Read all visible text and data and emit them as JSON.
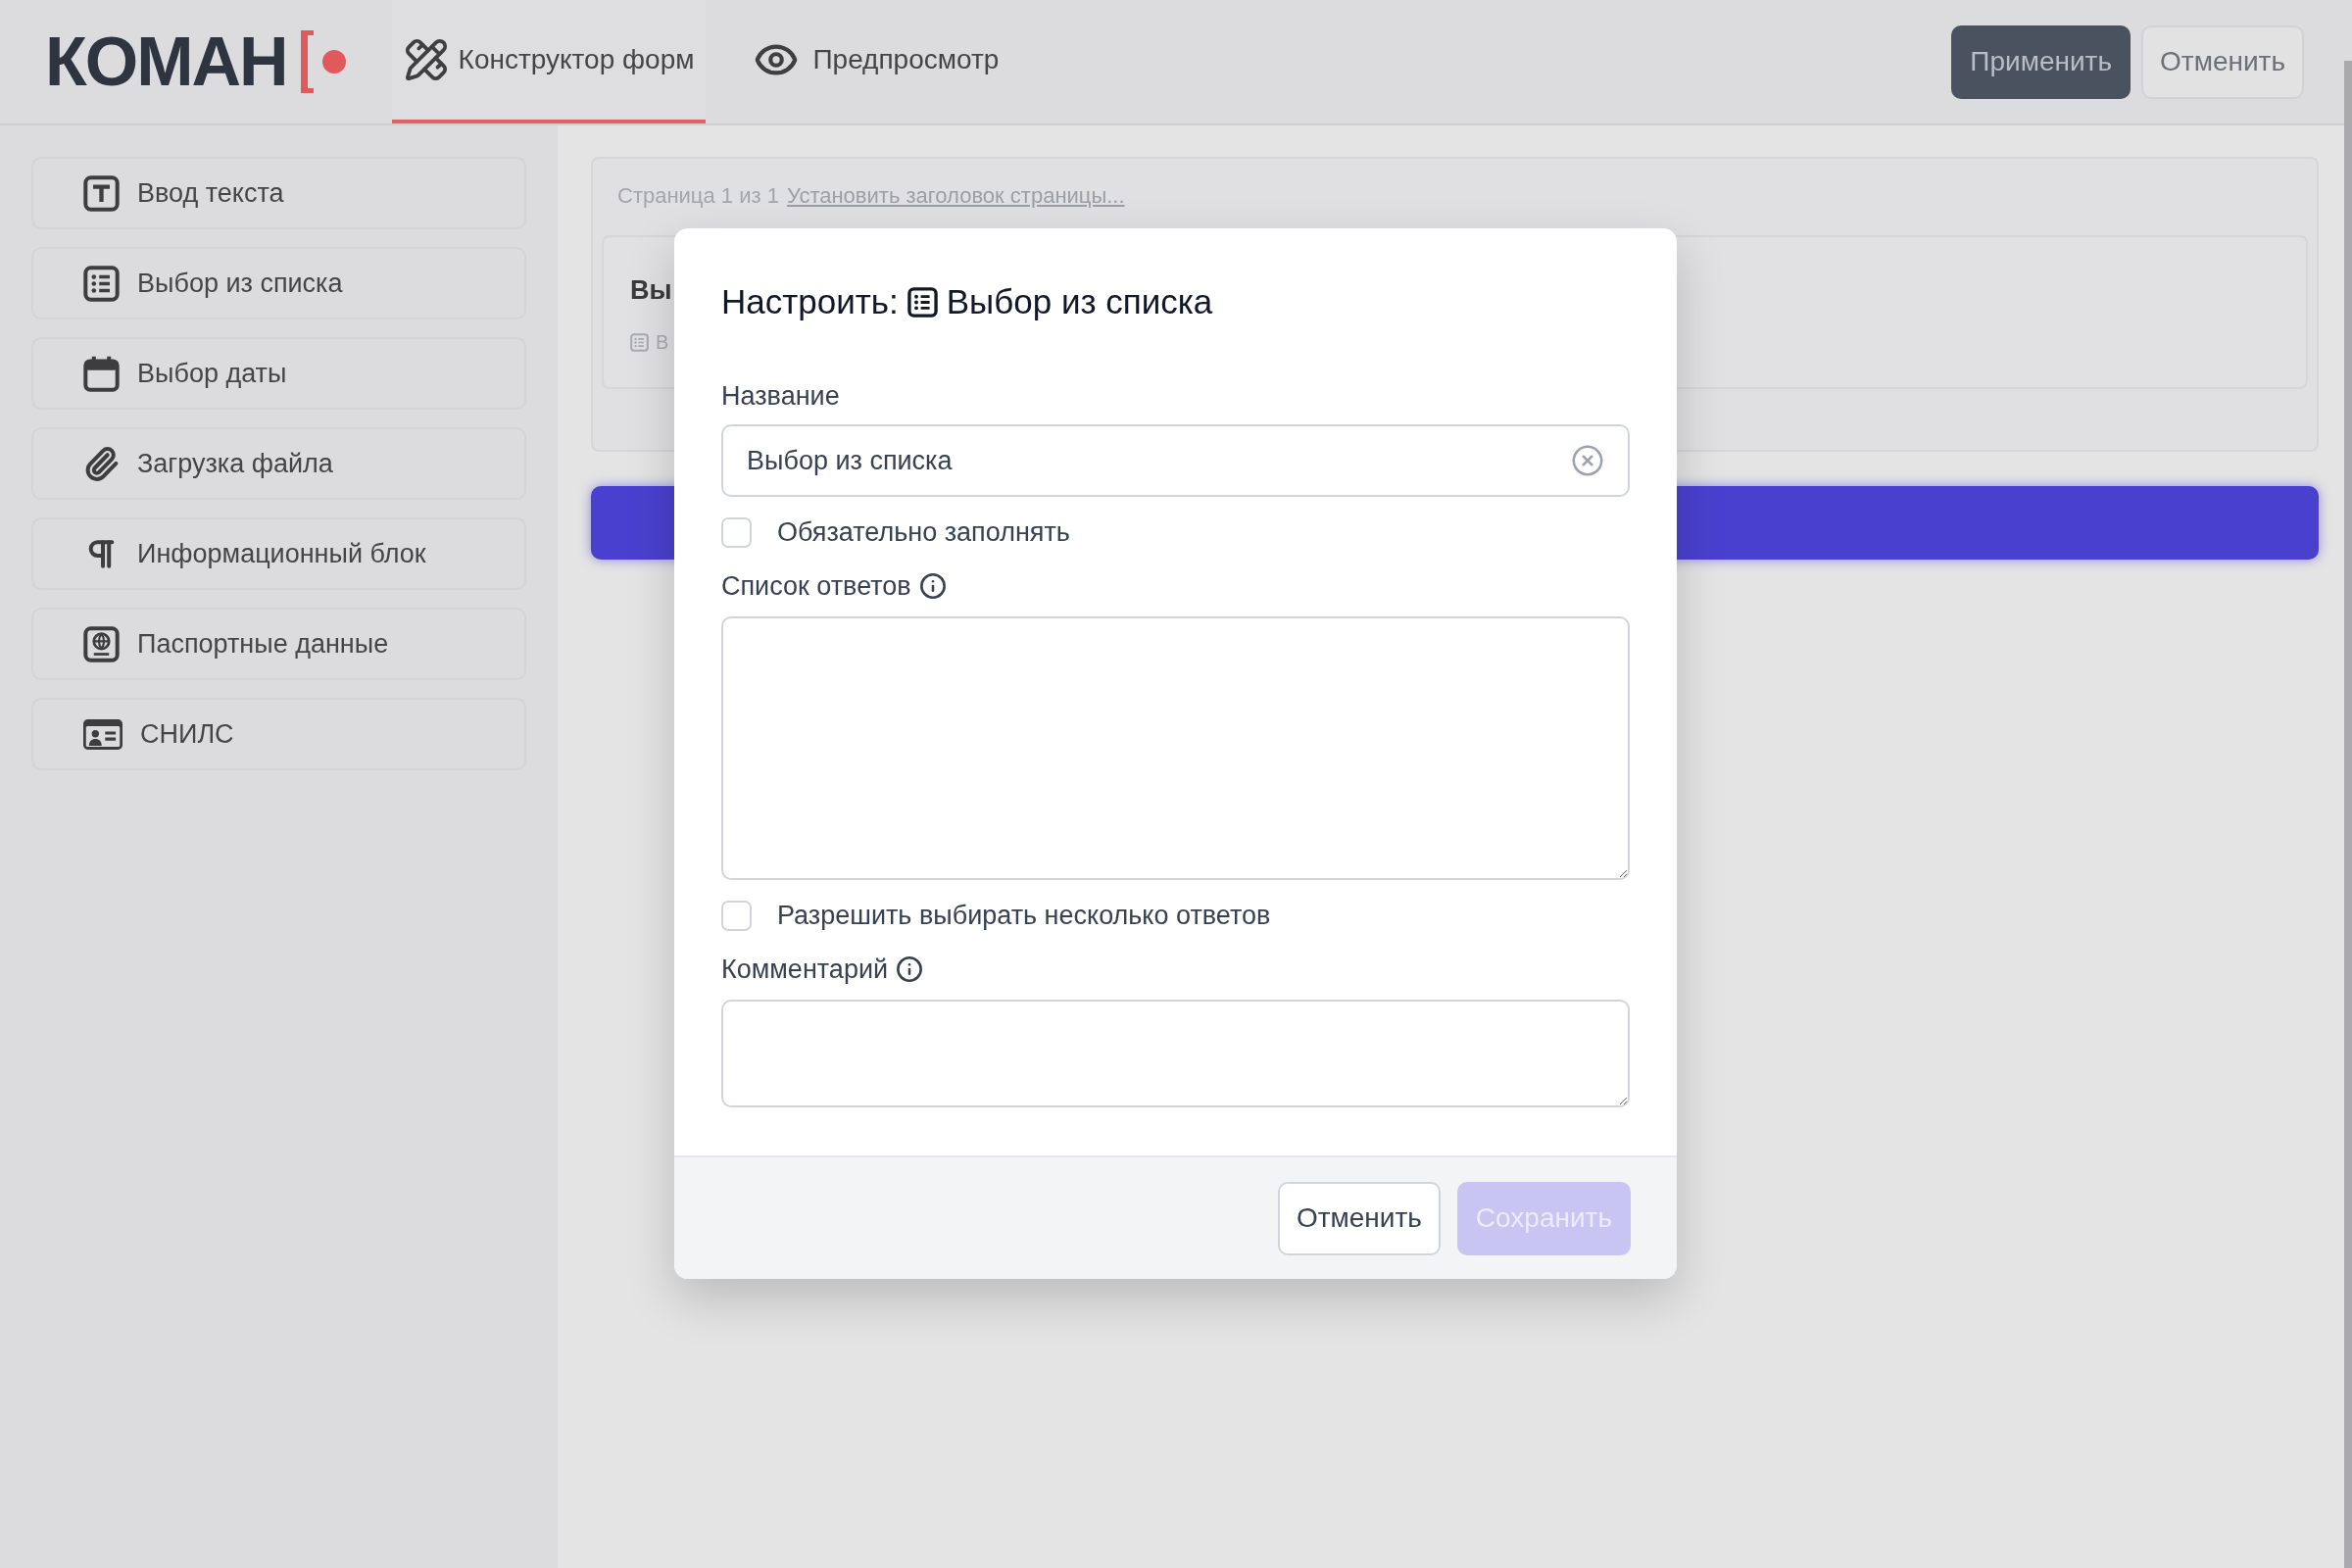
{
  "header": {
    "logo": "КОМАН",
    "tabs": [
      {
        "kind": "builder",
        "label": "Конструктор форм",
        "selected": true
      },
      {
        "kind": "preview",
        "label": "Предпросмотр",
        "selected": false
      }
    ],
    "buttons": [
      {
        "kind": "primary",
        "label": "Применить"
      },
      {
        "kind": "secondary",
        "label": "Отменить"
      }
    ]
  },
  "sidebar": {
    "items": [
      {
        "kind": "text",
        "label": "Ввод текста"
      },
      {
        "kind": "list",
        "label": "Выбор из списка"
      },
      {
        "kind": "date",
        "label": "Выбор даты"
      },
      {
        "kind": "file",
        "label": "Загрузка файла"
      },
      {
        "kind": "info",
        "label": "Информационный блок"
      },
      {
        "kind": "passport",
        "label": "Паспортные данные"
      },
      {
        "kind": "snils",
        "label": "СНИЛС"
      }
    ]
  },
  "canvas": {
    "page_counter": "Страница 1 из 1",
    "page_title_link": "Установить заголовок страницы...",
    "field_card": {
      "title": "Вы",
      "type_label": "В"
    }
  },
  "dialog": {
    "title_prefix": "Настроить:",
    "title": "Выбор из списка",
    "fields": [
      {
        "kind": "input",
        "label": "Название",
        "info": false,
        "value": "Выбор из списка"
      },
      {
        "kind": "checkbox",
        "label": "Обязательно заполнять",
        "checked": false
      },
      {
        "kind": "textarea",
        "label": "Список ответов",
        "info": true
      },
      {
        "kind": "checkbox",
        "label": "Разрешить выбирать несколько ответов",
        "checked": false
      },
      {
        "kind": "textarea",
        "label": "Комментарий",
        "info": true
      }
    ],
    "buttons": [
      {
        "kind": "secondary",
        "label": "Отменить",
        "disabled": false
      },
      {
        "kind": "primary",
        "label": "Сохранить",
        "disabled": true
      }
    ]
  }
}
